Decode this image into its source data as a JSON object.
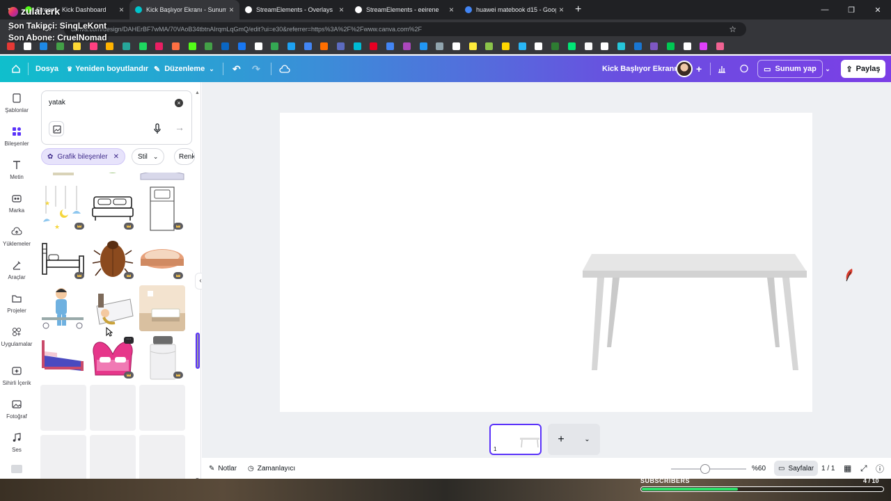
{
  "browser": {
    "tabs": [
      {
        "title": "Stream - Kick Dashboard",
        "color": "#53fc18",
        "active": false
      },
      {
        "title": "Kick Başlıyor Ekranı - Sunum",
        "color": "#00c4cc",
        "active": true
      },
      {
        "title": "StreamElements - Overlays",
        "color": "#ffffff",
        "active": false
      },
      {
        "title": "StreamElements - eeirene",
        "color": "#ffffff",
        "active": false
      },
      {
        "title": "huawei matebook d15 - Googl",
        "color": "#4285f4",
        "active": false
      }
    ],
    "url": "canva.com/design/DAHErBF7wMA/70VAoB34tbtnAIrqmLqGmQ/edit?ui=e30&referrer=https%3A%2F%2Fwww.canva.com%2F"
  },
  "overlay": {
    "brand": "zulal.erk",
    "last_follower": "Son Takipçi: SinqLeKont",
    "last_subscriber": "Son Abone: CruelNomad",
    "subscribers_label": "SUBSCRIBERS",
    "subscribers_count": "4 / 10",
    "subscribers_progress": 0.4,
    "accent": "#2ee06a"
  },
  "topbar": {
    "file": "Dosya",
    "resize": "Yeniden boyutlandır",
    "edit": "Düzenleme",
    "design_title": "Kick Başlıyor Ekranı",
    "present": "Sunum yap",
    "share": "Paylaş"
  },
  "rail": [
    {
      "label": "Şablonlar",
      "icon": "template-icon"
    },
    {
      "label": "Bileşenler",
      "icon": "elements-icon"
    },
    {
      "label": "Metin",
      "icon": "text-icon"
    },
    {
      "label": "Marka",
      "icon": "brand-icon"
    },
    {
      "label": "Yüklemeler",
      "icon": "upload-icon"
    },
    {
      "label": "Araçlar",
      "icon": "tools-icon"
    },
    {
      "label": "Projeler",
      "icon": "folder-icon"
    },
    {
      "label": "Uygulamalar",
      "icon": "apps-icon"
    },
    {
      "label": "Sihirli İçerik",
      "icon": "magic-icon"
    },
    {
      "label": "Fotoğraf",
      "icon": "photo-icon"
    },
    {
      "label": "Ses",
      "icon": "audio-icon"
    }
  ],
  "panel": {
    "search_value": "yatak",
    "chips": [
      "Grafik bileşenler",
      "Stil",
      "Renk"
    ]
  },
  "bottombar": {
    "notes": "Notlar",
    "timer": "Zamanlayıcı",
    "zoom": "%60",
    "zoom_level": 0.6,
    "pages": "Sayfalar",
    "page_count": "1 / 1",
    "thumb_number": "1"
  },
  "colors": {
    "brand_purple": "#5a32fa",
    "canvas_bg": "#eef0f3"
  }
}
